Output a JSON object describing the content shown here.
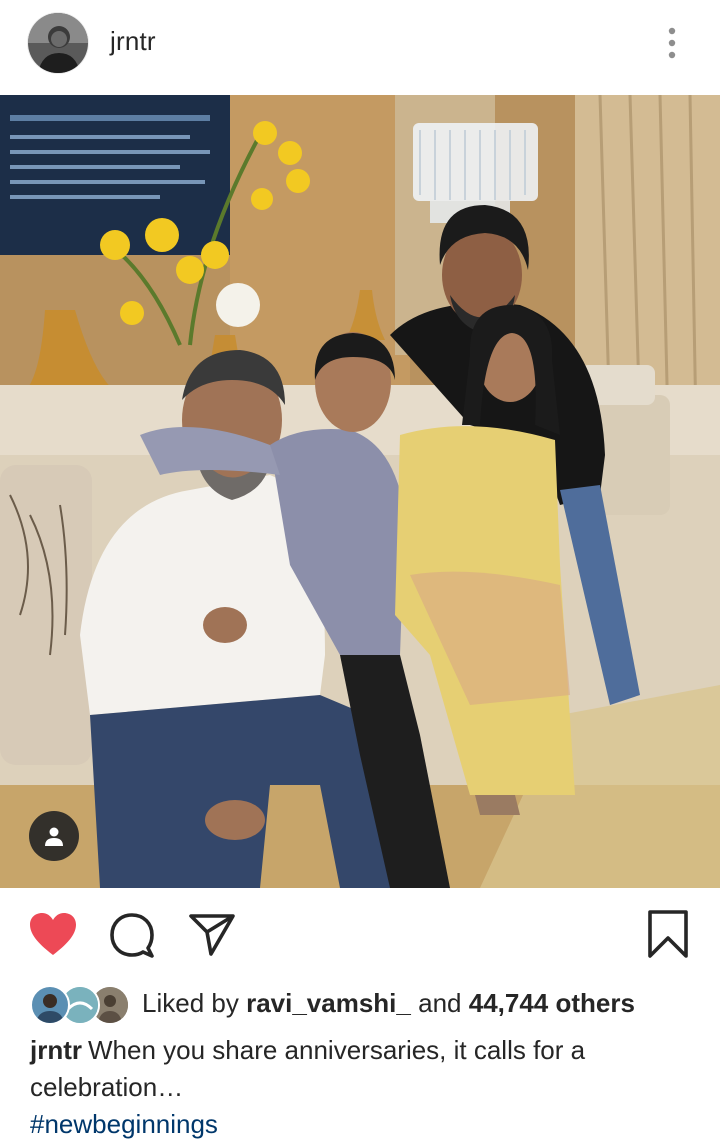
{
  "post": {
    "username": "jrntr",
    "avatar_icon": "profile-photo",
    "more_icon": "more-vertical-icon",
    "photo": {
      "tag_icon": "person-tag-icon"
    },
    "actions": {
      "liked": true,
      "like_icon": "heart-filled-icon",
      "like_color": "#ed4956",
      "comment_icon": "comment-icon",
      "share_icon": "send-icon",
      "save_icon": "bookmark-icon"
    },
    "likes": {
      "prefix": "Liked by",
      "top_liker": "ravi_vamshi_",
      "connector": "and",
      "others_count": "44,744 others"
    },
    "caption": {
      "username": "jrntr",
      "text": "When you share anniversaries, it calls for a celebration…",
      "hashtag": "#newbeginnings",
      "hashtag_color": "#00376b"
    }
  }
}
